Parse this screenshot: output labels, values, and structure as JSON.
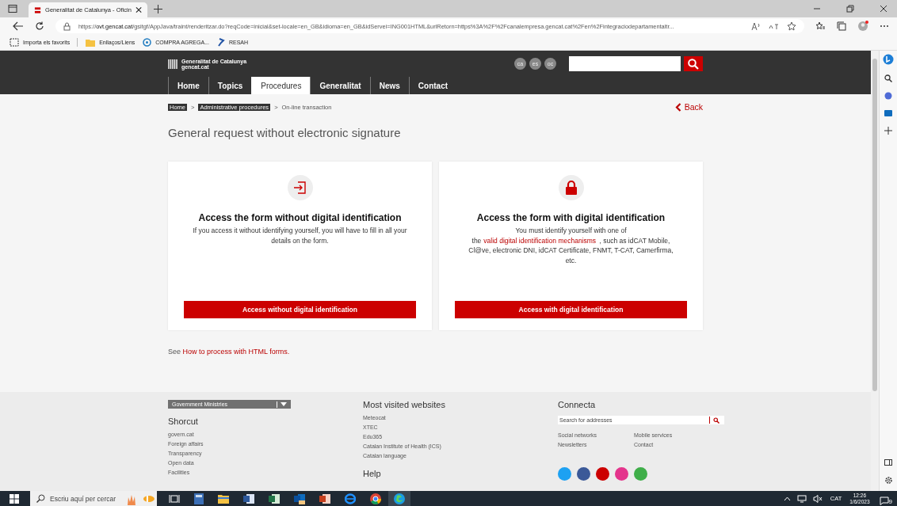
{
  "browser": {
    "tabs": [
      {
        "title": "Generalitat de Catalunya - Oficin",
        "selected": true
      }
    ],
    "url": {
      "host_prefix": "https://",
      "host": "ovt.gencat.cat",
      "path": "/gsitgf/AppJava/traint/renderitzar.do?reqCode=inicial&set-locale=en_GB&idioma=en_GB&idServei=ING001HTML&urlRetorn=https%3A%2F%2Fcanalempresa.gencat.cat%2Fen%2Fintegraciodepartamentaltr..."
    },
    "favorites": [
      {
        "label": "Importa els favorits",
        "kind": "import"
      },
      {
        "label": "Enllaços/Liens",
        "kind": "folder"
      },
      {
        "label": "COMPRA AGREGA...",
        "kind": "site"
      },
      {
        "label": "RESAH",
        "kind": "pin"
      }
    ]
  },
  "header": {
    "logo_line1": "Generalitat de Catalunya",
    "logo_line2": "gencat.cat",
    "languages": [
      "ca",
      "es",
      "oc"
    ],
    "nav": [
      {
        "label": "Home",
        "selected": false
      },
      {
        "label": "Topics",
        "selected": false
      },
      {
        "label": "Procedures",
        "selected": true
      },
      {
        "label": "Generalitat",
        "selected": false
      },
      {
        "label": "News",
        "selected": false
      },
      {
        "label": "Contact",
        "selected": false
      }
    ]
  },
  "breadcrumb": [
    {
      "label": "Home",
      "kind": "link"
    },
    {
      "label": "Administrative procedures",
      "kind": "link"
    },
    {
      "label": "On-line transaction",
      "kind": "current"
    }
  ],
  "breadcrumb_separator": ">",
  "back": "Back",
  "title": "General request without electronic signature",
  "cards": [
    {
      "kind": "open",
      "heading": "Access the form without digital identification",
      "text_before": "If you access it without identifying yourself, you will have to fill in all your details on the form.",
      "button": "Access without digital identification"
    },
    {
      "kind": "locked",
      "heading": "Access the form with digital identification",
      "text_before": "You must identify yourself with one of the",
      "link": "valid digital identification mechanisms",
      "text_after": ", such as idCAT Mobile, Cl@ve, electronic DNI, idCAT Certificate, FNMT, T-CAT, Camerfirma, etc.",
      "button": "Access with digital identification"
    }
  ],
  "see": {
    "prefix": "See",
    "link": "How to process with HTML forms."
  },
  "footer": {
    "ministries": "Government Ministries",
    "shortcut_title": "Shorcut",
    "shortcuts": [
      "govern.cat",
      "Foreign affairs",
      "Transparency",
      "Open data",
      "Facilities"
    ],
    "visited_title": "Most visited websites",
    "visited": [
      "Meteocat",
      "XTEC",
      "Edu365",
      "Catalan Institute of Health (ICS)",
      "Catalan language"
    ],
    "help_title": "Help",
    "connecta_title": "Connecta",
    "search_placeholder": "Search for addresses",
    "connecta_links": [
      "Social networks",
      "Mobile services",
      "Newsletters",
      "Contact"
    ],
    "social": [
      {
        "color": "#1da1f2"
      },
      {
        "color": "#3b5998"
      },
      {
        "color": "#cc0000"
      },
      {
        "color": "#e4348c"
      },
      {
        "color": "#3fae49"
      }
    ]
  },
  "taskbar": {
    "search_placeholder": "Escriu aquí per cercar",
    "language": "CAT",
    "time": "12:26",
    "date": "1/6/2023",
    "notifications": "9"
  }
}
